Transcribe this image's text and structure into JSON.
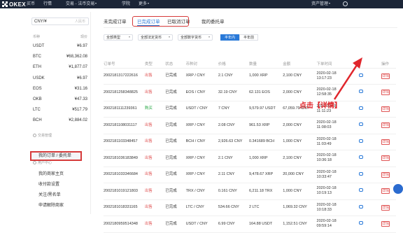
{
  "topbar": {
    "logo": "OKEX",
    "nav": [
      "买币",
      "行情",
      "交易 - 法币交易",
      "学院",
      "更多"
    ],
    "asset_mgmt": "资产管理",
    "right_icon": "user-icon"
  },
  "sidebar": {
    "currency_select": "CNY/¥",
    "currency_placeholder": "人民币",
    "col_coin": "币种",
    "col_price": "现价",
    "currencies": [
      {
        "name": "USDT",
        "price": "¥6.97"
      },
      {
        "name": "BTC",
        "price": "¥68,362.08"
      },
      {
        "name": "ETH",
        "price": "¥1,877.07"
      },
      {
        "name": "USDK",
        "price": "¥6.97"
      },
      {
        "name": "EOS",
        "price": "¥31.16"
      },
      {
        "name": "OKB",
        "price": "¥47.33"
      },
      {
        "name": "LTC",
        "price": "¥517.79"
      },
      {
        "name": "BCH",
        "price": "¥2,884.02"
      }
    ],
    "trade_mgmt_title": "交易管理",
    "my_orders": "我的订单 / 委托单",
    "user_center_title": "用户中心",
    "links": [
      "我的商家主页",
      "收付款设置",
      "关注/黑名单",
      "申请解除商家"
    ]
  },
  "tabs": {
    "items": [
      "未完成订单",
      "已完成订单",
      "已取消订单",
      "我的委托单"
    ],
    "active_index": 1
  },
  "filters": {
    "type": "全部类型",
    "fiat": "全部法定货币",
    "crypto": "全部数字货币",
    "period_half": "半年内",
    "period_before": "半年前"
  },
  "table": {
    "headers": [
      "订单号",
      "类型",
      "状态",
      "币种对",
      "价格",
      "数量",
      "金额",
      "下单时间",
      "",
      "操作"
    ],
    "detail_label": "详情",
    "rows": [
      {
        "id": "2002181317222616",
        "type": "出售",
        "side": "sell",
        "status": "已完成",
        "pair": "XRP / CNY",
        "price": "2.1 CNY",
        "qty": "1,000 XRP",
        "amount": "2,100 CNY",
        "date": "2020-02-18",
        "time": "13:17:23"
      },
      {
        "id": "2002181258348825",
        "type": "出售",
        "side": "sell",
        "status": "已完成",
        "pair": "EOS / CNY",
        "price": "32.19 CNY",
        "qty": "62.131 EOS",
        "amount": "2,000 CNY",
        "date": "2020-02-18",
        "time": "12:58:35"
      },
      {
        "id": "2002181111239361",
        "type": "购买",
        "side": "buy",
        "status": "已完成",
        "pair": "USDT / CNY",
        "price": "7 CNY",
        "qty": "9,579.97 USDT",
        "amount": "67,059.79 CNY",
        "date": "2020-02-18",
        "time": "11:11:23"
      },
      {
        "id": "2002181108031117",
        "type": "出售",
        "side": "sell",
        "status": "已完成",
        "pair": "XRP / CNY",
        "price": "2.08 CNY",
        "qty": "961.53 XRP",
        "amount": "2,000 CNY",
        "date": "2020-02-18",
        "time": "11:08:03"
      },
      {
        "id": "2002181103348457",
        "type": "出售",
        "side": "sell",
        "status": "已完成",
        "pair": "BCH / CNY",
        "price": "2,926.63 CNY",
        "qty": "0.341689 BCH",
        "amount": "1,000 CNY",
        "date": "2020-02-18",
        "time": "11:03:49"
      },
      {
        "id": "2002181036183849",
        "type": "出售",
        "side": "sell",
        "status": "已完成",
        "pair": "XRP / CNY",
        "price": "2.1 CNY",
        "qty": "1,000 XRP",
        "amount": "2,100 CNY",
        "date": "2020-02-18",
        "time": "10:36:18"
      },
      {
        "id": "2002181033346684",
        "type": "出售",
        "side": "sell",
        "status": "已完成",
        "pair": "XRP / CNY",
        "price": "2.11 CNY",
        "qty": "9,478.67 XRP",
        "amount": "20,000 CNY",
        "date": "2020-02-18",
        "time": "10:33:47"
      },
      {
        "id": "2002181019121803",
        "type": "出售",
        "side": "sell",
        "status": "已完成",
        "pair": "TRX / CNY",
        "price": "0.161 CNY",
        "qty": "6,211.18 TRX",
        "amount": "1,000 CNY",
        "date": "2020-02-18",
        "time": "10:19:13"
      },
      {
        "id": "2002181018331165",
        "type": "出售",
        "side": "sell",
        "status": "已完成",
        "pair": "LTC / CNY",
        "price": "534.66 CNY",
        "qty": "2 LTC",
        "amount": "1,069.32 CNY",
        "date": "2020-02-18",
        "time": "10:18:33"
      },
      {
        "id": "2002180959514348",
        "type": "出售",
        "side": "sell",
        "status": "已完成",
        "pair": "USDT / CNY",
        "price": "6.99 CNY",
        "qty": "164.88 USDT",
        "amount": "1,152.51 CNY",
        "date": "2020-02-18",
        "time": "09:59:14"
      }
    ]
  },
  "annotation": {
    "callout": "点击【详情】",
    "color": "#e0262c"
  },
  "colors": {
    "topbar": "#1b2537",
    "accent": "#2979d8",
    "sell": "#e05555",
    "buy": "#28a745",
    "highlight_box": "#d63b3b"
  }
}
